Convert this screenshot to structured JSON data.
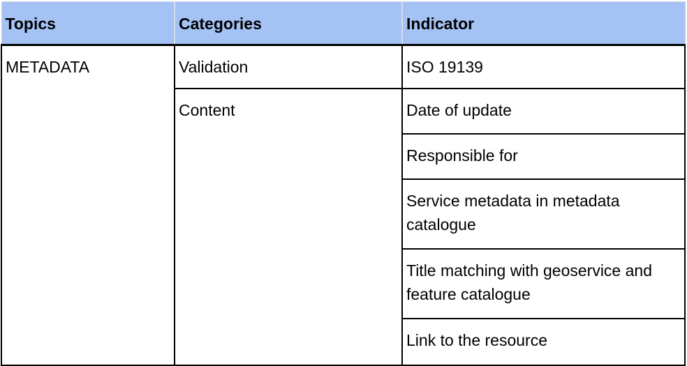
{
  "table": {
    "headers": {
      "topics": "Topics",
      "categories": "Categories",
      "indicator": "Indicator"
    },
    "topic": "METADATA",
    "categories": {
      "validation": "Validation",
      "content": "Content"
    },
    "indicators": [
      "ISO 19139",
      "Date of update",
      "Responsible for",
      "Service metadata in metadata catalogue",
      "Title matching with geoservice and feature catalogue",
      "Link to the resource"
    ],
    "colors": {
      "header_background": "#a4c2f4",
      "border": "#000000"
    }
  }
}
